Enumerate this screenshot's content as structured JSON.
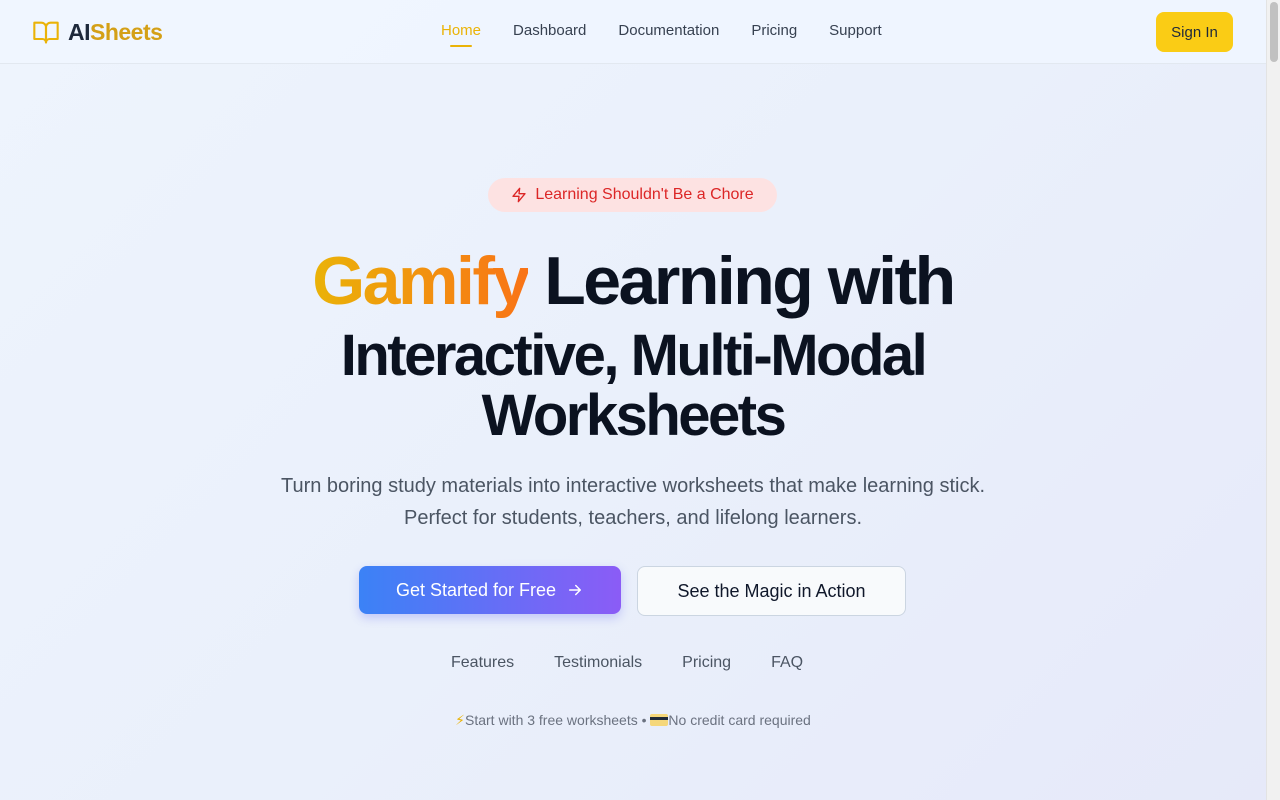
{
  "brand": {
    "name_part1": "AI",
    "name_part2": "Sheets",
    "icon": "book-open-icon"
  },
  "nav": {
    "items": [
      {
        "label": "Home",
        "active": true
      },
      {
        "label": "Dashboard",
        "active": false
      },
      {
        "label": "Documentation",
        "active": false
      },
      {
        "label": "Pricing",
        "active": false
      },
      {
        "label": "Support",
        "active": false
      }
    ]
  },
  "header": {
    "signin_label": "Sign In"
  },
  "hero": {
    "badge": {
      "icon": "zap-icon",
      "text": "Learning Shouldn't Be a Chore"
    },
    "headline_highlight": "Gamify",
    "headline_line1_rest": " Learning with",
    "headline_line2": "Interactive, Multi-Modal",
    "headline_line3": "Worksheets",
    "subtitle": "Turn boring study materials into interactive worksheets that make learning stick. Perfect for students, teachers, and lifelong learners.",
    "primary_cta": "Get Started for Free",
    "secondary_cta": "See the Magic in Action",
    "section_links": [
      "Features",
      "Testimonials",
      "Pricing",
      "FAQ"
    ],
    "footnote_part1": "Start with 3 free worksheets • ",
    "footnote_part2": "No credit card required"
  },
  "colors": {
    "accent": "#facc15",
    "highlight_gradient": [
      "#eab308",
      "#f97316"
    ],
    "cta_gradient": [
      "#3b82f6",
      "#8b5cf6"
    ],
    "badge_bg": "#fde2e2",
    "badge_text": "#dc2626"
  }
}
